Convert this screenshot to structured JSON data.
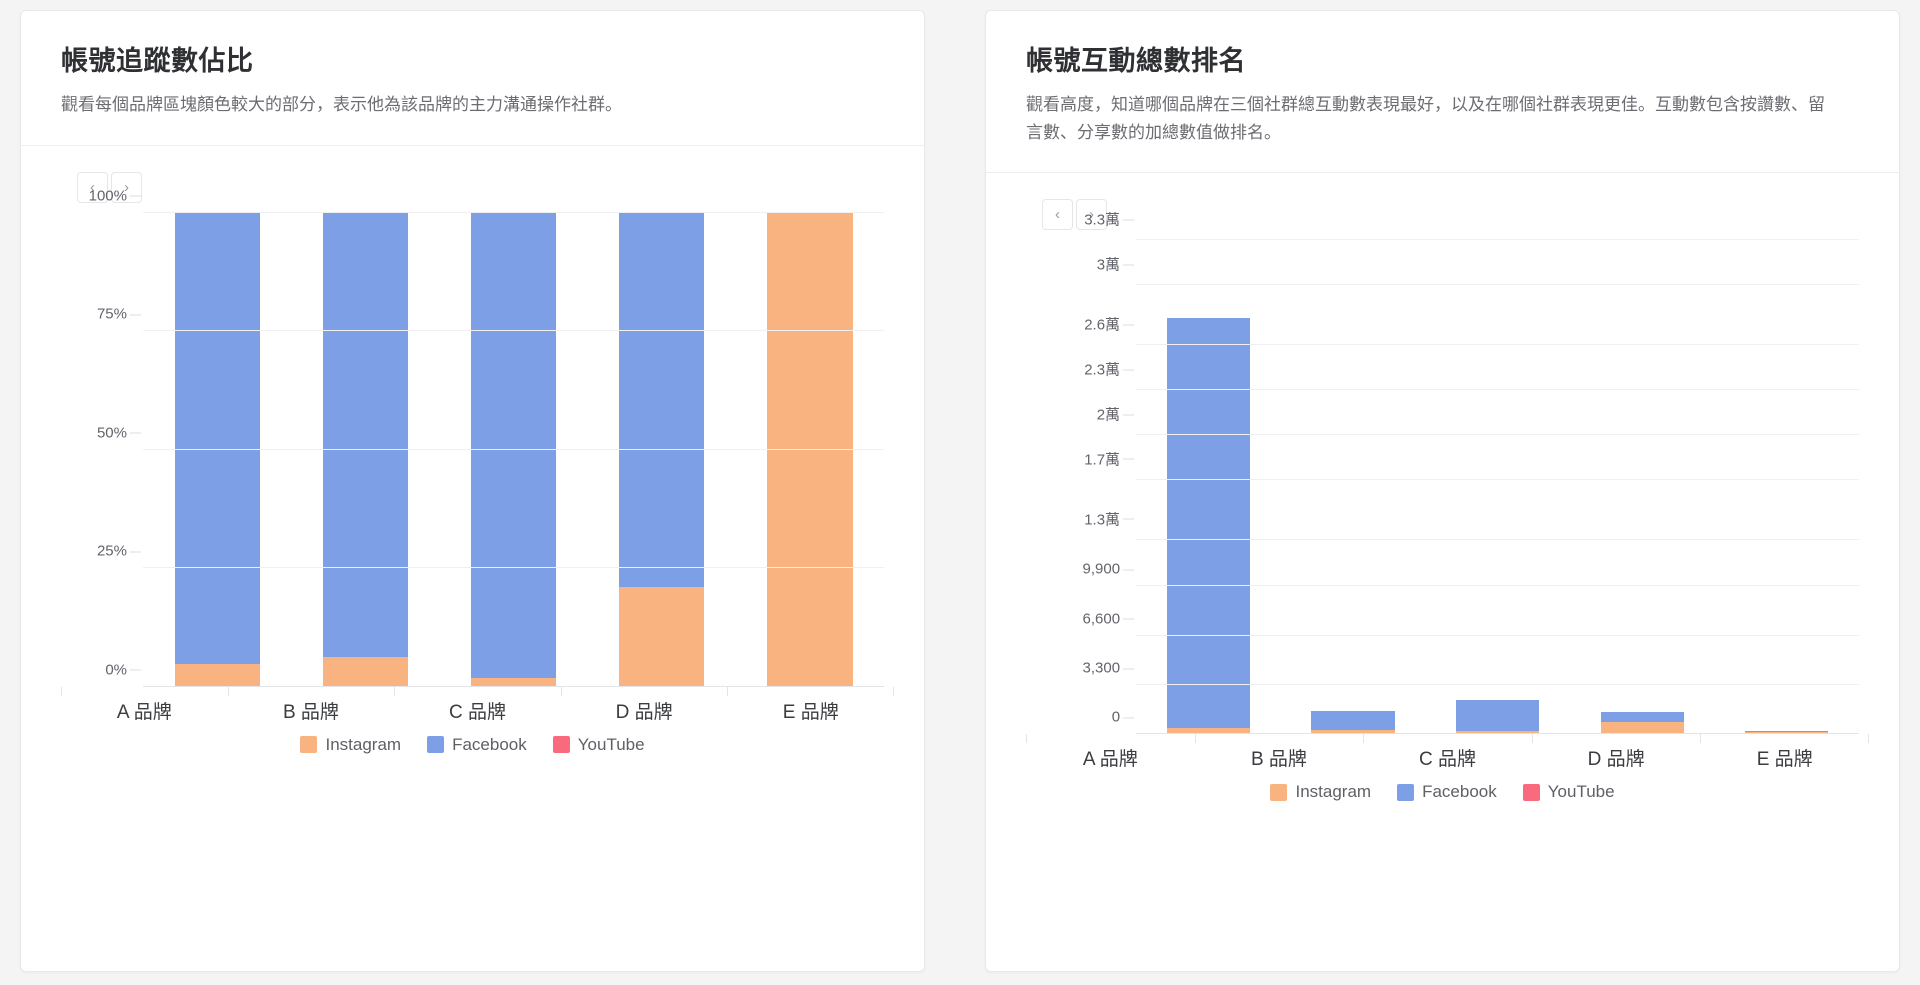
{
  "theme": {
    "page_bg": "#f4f4f5",
    "card_bg": "#ffffff",
    "instagram_color": "#f9b381",
    "facebook_color": "#7d9fe5",
    "youtube_color": "#fa6a7e"
  },
  "pager": {
    "prev_label": "‹",
    "next_label": "›"
  },
  "legend": [
    {
      "label": "Instagram",
      "color": "#f9b381"
    },
    {
      "label": "Facebook",
      "color": "#7d9fe5"
    },
    {
      "label": "YouTube",
      "color": "#fa6a7e"
    }
  ],
  "left_card": {
    "title": "帳號追蹤數佔比",
    "description": "觀看每個品牌區塊顏色較大的部分，表示他為該品牌的主力溝通操作社群。"
  },
  "right_card": {
    "title": "帳號互動總數排名",
    "description": "觀看高度，知道哪個品牌在三個社群總互動數表現最好，以及在哪個社群表現更佳。互動數包含按讚數、留言數、分享數的加總數值做排名。"
  },
  "chart_data": [
    {
      "id": "follower-share",
      "type": "bar",
      "stacked": true,
      "stack_mode": "percent",
      "title": "帳號追蹤數佔比",
      "xlabel": "",
      "ylabel": "",
      "categories": [
        "A 品牌",
        "B 品牌",
        "C 品牌",
        "D 品牌",
        "E 品牌"
      ],
      "ytick_labels": [
        "0%",
        "25%",
        "50%",
        "75%",
        "100%"
      ],
      "ytick_values": [
        0,
        25,
        50,
        75,
        100
      ],
      "ylim": [
        0,
        100
      ],
      "grid": true,
      "legend_position": "bottom",
      "series": [
        {
          "name": "Instagram",
          "color": "#f9b381",
          "values": [
            4.8,
            6.3,
            1.8,
            21.0,
            100.0
          ]
        },
        {
          "name": "Facebook",
          "color": "#7d9fe5",
          "values": [
            95.2,
            93.7,
            98.2,
            79.0,
            0.0
          ]
        },
        {
          "name": "YouTube",
          "color": "#fa6a7e",
          "values": [
            0,
            0,
            0,
            0,
            0
          ]
        }
      ]
    },
    {
      "id": "engagement-ranking",
      "type": "bar",
      "stacked": true,
      "stack_mode": "value",
      "title": "帳號互動總數排名",
      "xlabel": "",
      "ylabel": "",
      "categories": [
        "A 品牌",
        "B 品牌",
        "C 品牌",
        "D 品牌",
        "E 品牌"
      ],
      "ytick_labels": [
        "0",
        "3,300",
        "6,600",
        "9,900",
        "1.3萬",
        "1.7萬",
        "2萬",
        "2.3萬",
        "2.6萬",
        "3萬",
        "3.3萬"
      ],
      "ytick_values": [
        0,
        3300,
        6600,
        9900,
        13000,
        17000,
        20000,
        23000,
        26000,
        30000,
        33000
      ],
      "ylim": [
        0,
        33000
      ],
      "grid": true,
      "legend_position": "bottom",
      "series": [
        {
          "name": "Instagram",
          "color": "#f9b381",
          "values": [
            450,
            300,
            200,
            850,
            180
          ]
        },
        {
          "name": "Facebook",
          "color": "#7d9fe5",
          "values": [
            27350,
            1300,
            2100,
            650,
            30
          ]
        },
        {
          "name": "YouTube",
          "color": "#fa6a7e",
          "values": [
            0,
            0,
            0,
            0,
            0
          ]
        }
      ]
    }
  ]
}
